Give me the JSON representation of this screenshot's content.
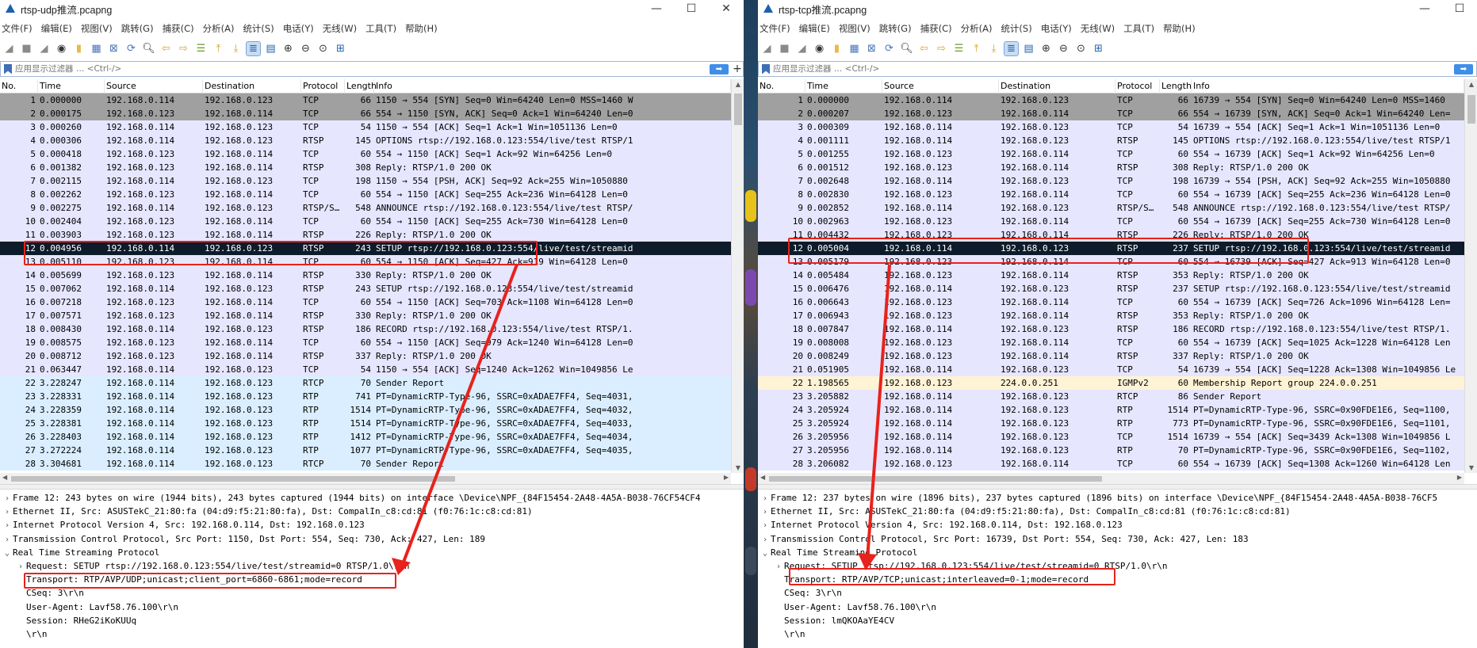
{
  "colors": {
    "tcp": "#e7e6ff",
    "rtcp": "#e4ffc7",
    "rtp": "#daeeff",
    "igmp": "#fff3d6",
    "tcp_handshake": "#a0a0a0",
    "selected_bg": "#0d1b2a",
    "selected_fg": "#ffffff",
    "annotation": "#e8221c"
  },
  "left": {
    "title": "rtsp-udp推流.pcapng",
    "menu": [
      "文件(F)",
      "编辑(E)",
      "视图(V)",
      "跳转(G)",
      "捕获(C)",
      "分析(A)",
      "统计(S)",
      "电话(Y)",
      "无线(W)",
      "工具(T)",
      "帮助(H)"
    ],
    "filter_placeholder": "应用显示过滤器 … <Ctrl-/>",
    "columns": [
      "No.",
      "Time",
      "Source",
      "Destination",
      "Protocol",
      "Length",
      "Info"
    ],
    "packets": [
      {
        "no": "1",
        "time": "0.000000",
        "src": "192.168.0.114",
        "dst": "192.168.0.123",
        "proto": "TCP",
        "len": "66",
        "info": "1150 → 554 [SYN] Seq=0 Win=64240 Len=0 MSS=1460 W",
        "cls": "tcp_handshake"
      },
      {
        "no": "2",
        "time": "0.000175",
        "src": "192.168.0.123",
        "dst": "192.168.0.114",
        "proto": "TCP",
        "len": "66",
        "info": "554 → 1150 [SYN, ACK] Seq=0 Ack=1 Win=64240 Len=0",
        "cls": "tcp_handshake"
      },
      {
        "no": "3",
        "time": "0.000260",
        "src": "192.168.0.114",
        "dst": "192.168.0.123",
        "proto": "TCP",
        "len": "54",
        "info": "1150 → 554 [ACK] Seq=1 Ack=1 Win=1051136 Len=0",
        "cls": "tcp"
      },
      {
        "no": "4",
        "time": "0.000306",
        "src": "192.168.0.114",
        "dst": "192.168.0.123",
        "proto": "RTSP",
        "len": "145",
        "info": "OPTIONS rtsp://192.168.0.123:554/live/test RTSP/1",
        "cls": "tcp"
      },
      {
        "no": "5",
        "time": "0.000418",
        "src": "192.168.0.123",
        "dst": "192.168.0.114",
        "proto": "TCP",
        "len": "60",
        "info": "554 → 1150 [ACK] Seq=1 Ack=92 Win=64256 Len=0",
        "cls": "tcp"
      },
      {
        "no": "6",
        "time": "0.001382",
        "src": "192.168.0.123",
        "dst": "192.168.0.114",
        "proto": "RTSP",
        "len": "308",
        "info": "Reply: RTSP/1.0 200 OK",
        "cls": "tcp"
      },
      {
        "no": "7",
        "time": "0.002115",
        "src": "192.168.0.114",
        "dst": "192.168.0.123",
        "proto": "TCP",
        "len": "198",
        "info": "1150 → 554 [PSH, ACK] Seq=92 Ack=255 Win=1050880",
        "cls": "tcp"
      },
      {
        "no": "8",
        "time": "0.002262",
        "src": "192.168.0.123",
        "dst": "192.168.0.114",
        "proto": "TCP",
        "len": "60",
        "info": "554 → 1150 [ACK] Seq=255 Ack=236 Win=64128 Len=0",
        "cls": "tcp"
      },
      {
        "no": "9",
        "time": "0.002275",
        "src": "192.168.0.114",
        "dst": "192.168.0.123",
        "proto": "RTSP/S…",
        "len": "548",
        "info": "ANNOUNCE rtsp://192.168.0.123:554/live/test RTSP/",
        "cls": "tcp"
      },
      {
        "no": "10",
        "time": "0.002404",
        "src": "192.168.0.123",
        "dst": "192.168.0.114",
        "proto": "TCP",
        "len": "60",
        "info": "554 → 1150 [ACK] Seq=255 Ack=730 Win=64128 Len=0",
        "cls": "tcp"
      },
      {
        "no": "11",
        "time": "0.003903",
        "src": "192.168.0.123",
        "dst": "192.168.0.114",
        "proto": "RTSP",
        "len": "226",
        "info": "Reply: RTSP/1.0 200 OK",
        "cls": "tcp"
      },
      {
        "no": "12",
        "time": "0.004956",
        "src": "192.168.0.114",
        "dst": "192.168.0.123",
        "proto": "RTSP",
        "len": "243",
        "info": "SETUP rtsp://192.168.0.123:554/live/test/streamid",
        "cls": "selected"
      },
      {
        "no": "13",
        "time": "0.005110",
        "src": "192.168.0.123",
        "dst": "192.168.0.114",
        "proto": "TCP",
        "len": "60",
        "info": "554 → 1150 [ACK] Seq=427 Ack=919 Win=64128 Len=0",
        "cls": "tcp"
      },
      {
        "no": "14",
        "time": "0.005699",
        "src": "192.168.0.123",
        "dst": "192.168.0.114",
        "proto": "RTSP",
        "len": "330",
        "info": "Reply: RTSP/1.0 200 OK",
        "cls": "tcp"
      },
      {
        "no": "15",
        "time": "0.007062",
        "src": "192.168.0.114",
        "dst": "192.168.0.123",
        "proto": "RTSP",
        "len": "243",
        "info": "SETUP rtsp://192.168.0.123:554/live/test/streamid",
        "cls": "tcp"
      },
      {
        "no": "16",
        "time": "0.007218",
        "src": "192.168.0.123",
        "dst": "192.168.0.114",
        "proto": "TCP",
        "len": "60",
        "info": "554 → 1150 [ACK] Seq=703 Ack=1108 Win=64128 Len=0",
        "cls": "tcp"
      },
      {
        "no": "17",
        "time": "0.007571",
        "src": "192.168.0.123",
        "dst": "192.168.0.114",
        "proto": "RTSP",
        "len": "330",
        "info": "Reply: RTSP/1.0 200 OK",
        "cls": "tcp"
      },
      {
        "no": "18",
        "time": "0.008430",
        "src": "192.168.0.114",
        "dst": "192.168.0.123",
        "proto": "RTSP",
        "len": "186",
        "info": "RECORD rtsp://192.168.0.123:554/live/test RTSP/1.",
        "cls": "tcp"
      },
      {
        "no": "19",
        "time": "0.008575",
        "src": "192.168.0.123",
        "dst": "192.168.0.114",
        "proto": "TCP",
        "len": "60",
        "info": "554 → 1150 [ACK] Seq=979 Ack=1240 Win=64128 Len=0",
        "cls": "tcp"
      },
      {
        "no": "20",
        "time": "0.008712",
        "src": "192.168.0.123",
        "dst": "192.168.0.114",
        "proto": "RTSP",
        "len": "337",
        "info": "Reply: RTSP/1.0 200 OK",
        "cls": "tcp"
      },
      {
        "no": "21",
        "time": "0.063447",
        "src": "192.168.0.114",
        "dst": "192.168.0.123",
        "proto": "TCP",
        "len": "54",
        "info": "1150 → 554 [ACK] Seq=1240 Ack=1262 Win=1049856 Le",
        "cls": "tcp"
      },
      {
        "no": "22",
        "time": "3.228247",
        "src": "192.168.0.114",
        "dst": "192.168.0.123",
        "proto": "RTCP",
        "len": "70",
        "info": "Sender Report",
        "cls": "rtp"
      },
      {
        "no": "23",
        "time": "3.228331",
        "src": "192.168.0.114",
        "dst": "192.168.0.123",
        "proto": "RTP",
        "len": "741",
        "info": "PT=DynamicRTP-Type-96, SSRC=0xADAE7FF4, Seq=4031,",
        "cls": "rtp"
      },
      {
        "no": "24",
        "time": "3.228359",
        "src": "192.168.0.114",
        "dst": "192.168.0.123",
        "proto": "RTP",
        "len": "1514",
        "info": "PT=DynamicRTP-Type-96, SSRC=0xADAE7FF4, Seq=4032,",
        "cls": "rtp"
      },
      {
        "no": "25",
        "time": "3.228381",
        "src": "192.168.0.114",
        "dst": "192.168.0.123",
        "proto": "RTP",
        "len": "1514",
        "info": "PT=DynamicRTP-Type-96, SSRC=0xADAE7FF4, Seq=4033,",
        "cls": "rtp"
      },
      {
        "no": "26",
        "time": "3.228403",
        "src": "192.168.0.114",
        "dst": "192.168.0.123",
        "proto": "RTP",
        "len": "1412",
        "info": "PT=DynamicRTP-Type-96, SSRC=0xADAE7FF4, Seq=4034,",
        "cls": "rtp"
      },
      {
        "no": "27",
        "time": "3.272224",
        "src": "192.168.0.114",
        "dst": "192.168.0.123",
        "proto": "RTP",
        "len": "1077",
        "info": "PT=DynamicRTP-Type-96, SSRC=0xADAE7FF4, Seq=4035,",
        "cls": "rtp"
      },
      {
        "no": "28",
        "time": "3.304681",
        "src": "192.168.0.114",
        "dst": "192.168.0.123",
        "proto": "RTCP",
        "len": "70",
        "info": "Sender Report",
        "cls": "rtp"
      }
    ],
    "details": [
      {
        "tw": "›",
        "text": "Frame 12: 243 bytes on wire (1944 bits), 243 bytes captured (1944 bits) on interface \\Device\\NPF_{84F15454-2A48-4A5A-B038-76CF54CF4",
        "indent": 0
      },
      {
        "tw": "›",
        "text": "Ethernet II, Src: ASUSTekC_21:80:fa (04:d9:f5:21:80:fa), Dst: CompalIn_c8:cd:81 (f0:76:1c:c8:cd:81)",
        "indent": 0
      },
      {
        "tw": "›",
        "text": "Internet Protocol Version 4, Src: 192.168.0.114, Dst: 192.168.0.123",
        "indent": 0
      },
      {
        "tw": "›",
        "text": "Transmission Control Protocol, Src Port: 1150, Dst Port: 554, Seq: 730, Ack: 427, Len: 189",
        "indent": 0
      },
      {
        "tw": "⌄",
        "text": "Real Time Streaming Protocol",
        "indent": 0
      },
      {
        "tw": "›",
        "text": "Request: SETUP rtsp://192.168.0.123:554/live/test/streamid=0 RTSP/1.0\\r\\n",
        "indent": 1
      },
      {
        "tw": "",
        "text": "Transport: RTP/AVP/UDP;unicast;client_port=6860-6861;mode=record",
        "indent": 1
      },
      {
        "tw": "",
        "text": "CSeq: 3\\r\\n",
        "indent": 1
      },
      {
        "tw": "",
        "text": "User-Agent: Lavf58.76.100\\r\\n",
        "indent": 1
      },
      {
        "tw": "",
        "text": "Session: RHeG2iKoKUUq",
        "indent": 1
      },
      {
        "tw": "",
        "text": "\\r\\n",
        "indent": 1
      }
    ]
  },
  "right": {
    "title": "rtsp-tcp推流.pcapng",
    "menu": [
      "文件(F)",
      "编辑(E)",
      "视图(V)",
      "跳转(G)",
      "捕获(C)",
      "分析(A)",
      "统计(S)",
      "电话(Y)",
      "无线(W)",
      "工具(T)",
      "帮助(H)"
    ],
    "filter_placeholder": "应用显示过滤器 … <Ctrl-/>",
    "columns": [
      "No.",
      "Time",
      "Source",
      "Destination",
      "Protocol",
      "Length",
      "Info"
    ],
    "packets": [
      {
        "no": "1",
        "time": "0.000000",
        "src": "192.168.0.114",
        "dst": "192.168.0.123",
        "proto": "TCP",
        "len": "66",
        "info": "16739 → 554 [SYN] Seq=0 Win=64240 Len=0 MSS=1460",
        "cls": "tcp_handshake"
      },
      {
        "no": "2",
        "time": "0.000207",
        "src": "192.168.0.123",
        "dst": "192.168.0.114",
        "proto": "TCP",
        "len": "66",
        "info": "554 → 16739 [SYN, ACK] Seq=0 Ack=1 Win=64240 Len=",
        "cls": "tcp_handshake"
      },
      {
        "no": "3",
        "time": "0.000309",
        "src": "192.168.0.114",
        "dst": "192.168.0.123",
        "proto": "TCP",
        "len": "54",
        "info": "16739 → 554 [ACK] Seq=1 Ack=1 Win=1051136 Len=0",
        "cls": "tcp"
      },
      {
        "no": "4",
        "time": "0.001111",
        "src": "192.168.0.114",
        "dst": "192.168.0.123",
        "proto": "RTSP",
        "len": "145",
        "info": "OPTIONS rtsp://192.168.0.123:554/live/test RTSP/1",
        "cls": "tcp"
      },
      {
        "no": "5",
        "time": "0.001255",
        "src": "192.168.0.123",
        "dst": "192.168.0.114",
        "proto": "TCP",
        "len": "60",
        "info": "554 → 16739 [ACK] Seq=1 Ack=92 Win=64256 Len=0",
        "cls": "tcp"
      },
      {
        "no": "6",
        "time": "0.001512",
        "src": "192.168.0.123",
        "dst": "192.168.0.114",
        "proto": "RTSP",
        "len": "308",
        "info": "Reply: RTSP/1.0 200 OK",
        "cls": "tcp"
      },
      {
        "no": "7",
        "time": "0.002648",
        "src": "192.168.0.114",
        "dst": "192.168.0.123",
        "proto": "TCP",
        "len": "198",
        "info": "16739 → 554 [PSH, ACK] Seq=92 Ack=255 Win=1050880",
        "cls": "tcp"
      },
      {
        "no": "8",
        "time": "0.002830",
        "src": "192.168.0.123",
        "dst": "192.168.0.114",
        "proto": "TCP",
        "len": "60",
        "info": "554 → 16739 [ACK] Seq=255 Ack=236 Win=64128 Len=0",
        "cls": "tcp"
      },
      {
        "no": "9",
        "time": "0.002852",
        "src": "192.168.0.114",
        "dst": "192.168.0.123",
        "proto": "RTSP/S…",
        "len": "548",
        "info": "ANNOUNCE rtsp://192.168.0.123:554/live/test RTSP/",
        "cls": "tcp"
      },
      {
        "no": "10",
        "time": "0.002963",
        "src": "192.168.0.123",
        "dst": "192.168.0.114",
        "proto": "TCP",
        "len": "60",
        "info": "554 → 16739 [ACK] Seq=255 Ack=730 Win=64128 Len=0",
        "cls": "tcp"
      },
      {
        "no": "11",
        "time": "0.004432",
        "src": "192.168.0.123",
        "dst": "192.168.0.114",
        "proto": "RTSP",
        "len": "226",
        "info": "Reply: RTSP/1.0 200 OK",
        "cls": "tcp"
      },
      {
        "no": "12",
        "time": "0.005004",
        "src": "192.168.0.114",
        "dst": "192.168.0.123",
        "proto": "RTSP",
        "len": "237",
        "info": "SETUP rtsp://192.168.0.123:554/live/test/streamid",
        "cls": "selected"
      },
      {
        "no": "13",
        "time": "0.005179",
        "src": "192.168.0.123",
        "dst": "192.168.0.114",
        "proto": "TCP",
        "len": "60",
        "info": "554 → 16739 [ACK] Seq=427 Ack=913 Win=64128 Len=0",
        "cls": "tcp"
      },
      {
        "no": "14",
        "time": "0.005484",
        "src": "192.168.0.123",
        "dst": "192.168.0.114",
        "proto": "RTSP",
        "len": "353",
        "info": "Reply: RTSP/1.0 200 OK",
        "cls": "tcp"
      },
      {
        "no": "15",
        "time": "0.006476",
        "src": "192.168.0.114",
        "dst": "192.168.0.123",
        "proto": "RTSP",
        "len": "237",
        "info": "SETUP rtsp://192.168.0.123:554/live/test/streamid",
        "cls": "tcp"
      },
      {
        "no": "16",
        "time": "0.006643",
        "src": "192.168.0.123",
        "dst": "192.168.0.114",
        "proto": "TCP",
        "len": "60",
        "info": "554 → 16739 [ACK] Seq=726 Ack=1096 Win=64128 Len=",
        "cls": "tcp"
      },
      {
        "no": "17",
        "time": "0.006943",
        "src": "192.168.0.123",
        "dst": "192.168.0.114",
        "proto": "RTSP",
        "len": "353",
        "info": "Reply: RTSP/1.0 200 OK",
        "cls": "tcp"
      },
      {
        "no": "18",
        "time": "0.007847",
        "src": "192.168.0.114",
        "dst": "192.168.0.123",
        "proto": "RTSP",
        "len": "186",
        "info": "RECORD rtsp://192.168.0.123:554/live/test RTSP/1.",
        "cls": "tcp"
      },
      {
        "no": "19",
        "time": "0.008008",
        "src": "192.168.0.123",
        "dst": "192.168.0.114",
        "proto": "TCP",
        "len": "60",
        "info": "554 → 16739 [ACK] Seq=1025 Ack=1228 Win=64128 Len",
        "cls": "tcp"
      },
      {
        "no": "20",
        "time": "0.008249",
        "src": "192.168.0.123",
        "dst": "192.168.0.114",
        "proto": "RTSP",
        "len": "337",
        "info": "Reply: RTSP/1.0 200 OK",
        "cls": "tcp"
      },
      {
        "no": "21",
        "time": "0.051905",
        "src": "192.168.0.114",
        "dst": "192.168.0.123",
        "proto": "TCP",
        "len": "54",
        "info": "16739 → 554 [ACK] Seq=1228 Ack=1308 Win=1049856 Le",
        "cls": "tcp"
      },
      {
        "no": "22",
        "time": "1.198565",
        "src": "192.168.0.123",
        "dst": "224.0.0.251",
        "proto": "IGMPv2",
        "len": "60",
        "info": "Membership Report group 224.0.0.251",
        "cls": "igmp"
      },
      {
        "no": "23",
        "time": "3.205882",
        "src": "192.168.0.114",
        "dst": "192.168.0.123",
        "proto": "RTCP",
        "len": "86",
        "info": "Sender Report",
        "cls": "tcp"
      },
      {
        "no": "24",
        "time": "3.205924",
        "src": "192.168.0.114",
        "dst": "192.168.0.123",
        "proto": "RTP",
        "len": "1514",
        "info": "PT=DynamicRTP-Type-96, SSRC=0x90FDE1E6, Seq=1100,",
        "cls": "tcp"
      },
      {
        "no": "25",
        "time": "3.205924",
        "src": "192.168.0.114",
        "dst": "192.168.0.123",
        "proto": "RTP",
        "len": "773",
        "info": "PT=DynamicRTP-Type-96, SSRC=0x90FDE1E6, Seq=1101,",
        "cls": "tcp"
      },
      {
        "no": "26",
        "time": "3.205956",
        "src": "192.168.0.114",
        "dst": "192.168.0.123",
        "proto": "TCP",
        "len": "1514",
        "info": "16739 → 554 [ACK] Seq=3439 Ack=1308 Win=1049856 L",
        "cls": "tcp"
      },
      {
        "no": "27",
        "time": "3.205956",
        "src": "192.168.0.114",
        "dst": "192.168.0.123",
        "proto": "RTP",
        "len": "70",
        "info": "PT=DynamicRTP-Type-96, SSRC=0x90FDE1E6, Seq=1102,",
        "cls": "tcp"
      },
      {
        "no": "28",
        "time": "3.206082",
        "src": "192.168.0.123",
        "dst": "192.168.0.114",
        "proto": "TCP",
        "len": "60",
        "info": "554 → 16739 [ACK] Seq=1308 Ack=1260 Win=64128 Len",
        "cls": "tcp"
      }
    ],
    "details": [
      {
        "tw": "›",
        "text": "Frame 12: 237 bytes on wire (1896 bits), 237 bytes captured (1896 bits) on interface \\Device\\NPF_{84F15454-2A48-4A5A-B038-76CF5",
        "indent": 0
      },
      {
        "tw": "›",
        "text": "Ethernet II, Src: ASUSTekC_21:80:fa (04:d9:f5:21:80:fa), Dst: CompalIn_c8:cd:81 (f0:76:1c:c8:cd:81)",
        "indent": 0
      },
      {
        "tw": "›",
        "text": "Internet Protocol Version 4, Src: 192.168.0.114, Dst: 192.168.0.123",
        "indent": 0
      },
      {
        "tw": "›",
        "text": "Transmission Control Protocol, Src Port: 16739, Dst Port: 554, Seq: 730, Ack: 427, Len: 183",
        "indent": 0
      },
      {
        "tw": "⌄",
        "text": "Real Time Streaming Protocol",
        "indent": 0
      },
      {
        "tw": "›",
        "text": "Request: SETUP rtsp://192.168.0.123:554/live/test/streamid=0 RTSP/1.0\\r\\n",
        "indent": 1
      },
      {
        "tw": "",
        "text": "Transport: RTP/AVP/TCP;unicast;interleaved=0-1;mode=record",
        "indent": 1
      },
      {
        "tw": "",
        "text": "CSeq: 3\\r\\n",
        "indent": 1
      },
      {
        "tw": "",
        "text": "User-Agent: Lavf58.76.100\\r\\n",
        "indent": 1
      },
      {
        "tw": "",
        "text": "Session: lmQKOAaYE4CV",
        "indent": 1
      },
      {
        "tw": "",
        "text": "\\r\\n",
        "indent": 1
      }
    ]
  }
}
